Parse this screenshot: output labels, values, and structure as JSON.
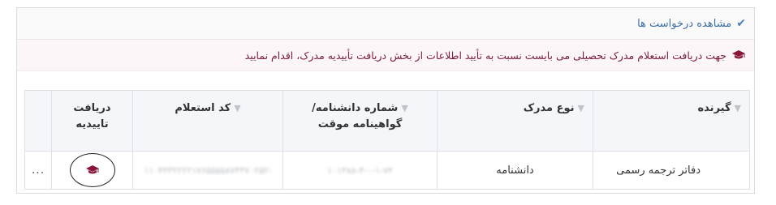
{
  "header": {
    "title": "مشاهده درخواست ها",
    "icon": "check-icon"
  },
  "notice": {
    "text": "جهت دریافت استعلام مدرک تحصیلی می بایست نسبت به تأیید اطلاعات از بخش دریافت تأییدیه مدرک، اقدام نمایید",
    "icon": "graduation-cap-icon"
  },
  "table": {
    "columns": [
      {
        "label": "گیرنده"
      },
      {
        "label": "نوع مدرک"
      },
      {
        "label": "شماره دانشنامه/گواهینامه موقت"
      },
      {
        "label": "کد استعلام"
      },
      {
        "label": "دریافت تاییدیه"
      },
      {
        "label": ""
      }
    ],
    "rows": [
      {
        "recipient": "دفاتر ترجمه رسمی",
        "doc_type": "دانشنامه",
        "cert_number": "۱۰۱۳۸۸-۴-۰-۱-۷۴",
        "inquiry_code": "-۱۱۰۴۳۳۲۲۲۲۱۷۶۵۵۵۵۸۷۴۳۷۰۲۵۲",
        "confirm_icon": "graduation-cap-icon",
        "more": "..."
      }
    ]
  },
  "colors": {
    "accent_blue": "#3a6ea5",
    "notice_maroon": "#7a1c3a",
    "cap_icon": "#8b1538"
  }
}
